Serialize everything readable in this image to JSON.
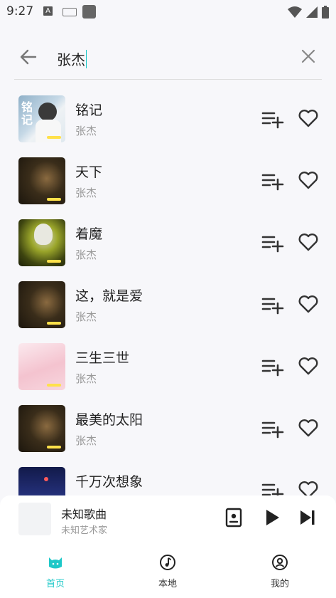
{
  "status": {
    "time": "9:27",
    "a_glyph": "A"
  },
  "search": {
    "query": "张杰"
  },
  "songs": [
    {
      "title": "铭记",
      "artist": "张杰",
      "cover_text": "铭记"
    },
    {
      "title": "天下",
      "artist": "张杰"
    },
    {
      "title": "着魔",
      "artist": "张杰"
    },
    {
      "title": "这，就是爱",
      "artist": "张杰"
    },
    {
      "title": "三生三世",
      "artist": "张杰"
    },
    {
      "title": "最美的太阳",
      "artist": "张杰"
    },
    {
      "title": "千万次想象",
      "artist": ""
    }
  ],
  "player": {
    "title": "未知歌曲",
    "artist": "未知艺术家"
  },
  "tabs": [
    {
      "label": "首页",
      "icon": "cat-icon",
      "active": true
    },
    {
      "label": "本地",
      "icon": "music-note-icon",
      "active": false
    },
    {
      "label": "我的",
      "icon": "profile-icon",
      "active": false
    }
  ],
  "colors": {
    "accent": "#1ec8c8",
    "cover_bar": "#ffe14a"
  }
}
